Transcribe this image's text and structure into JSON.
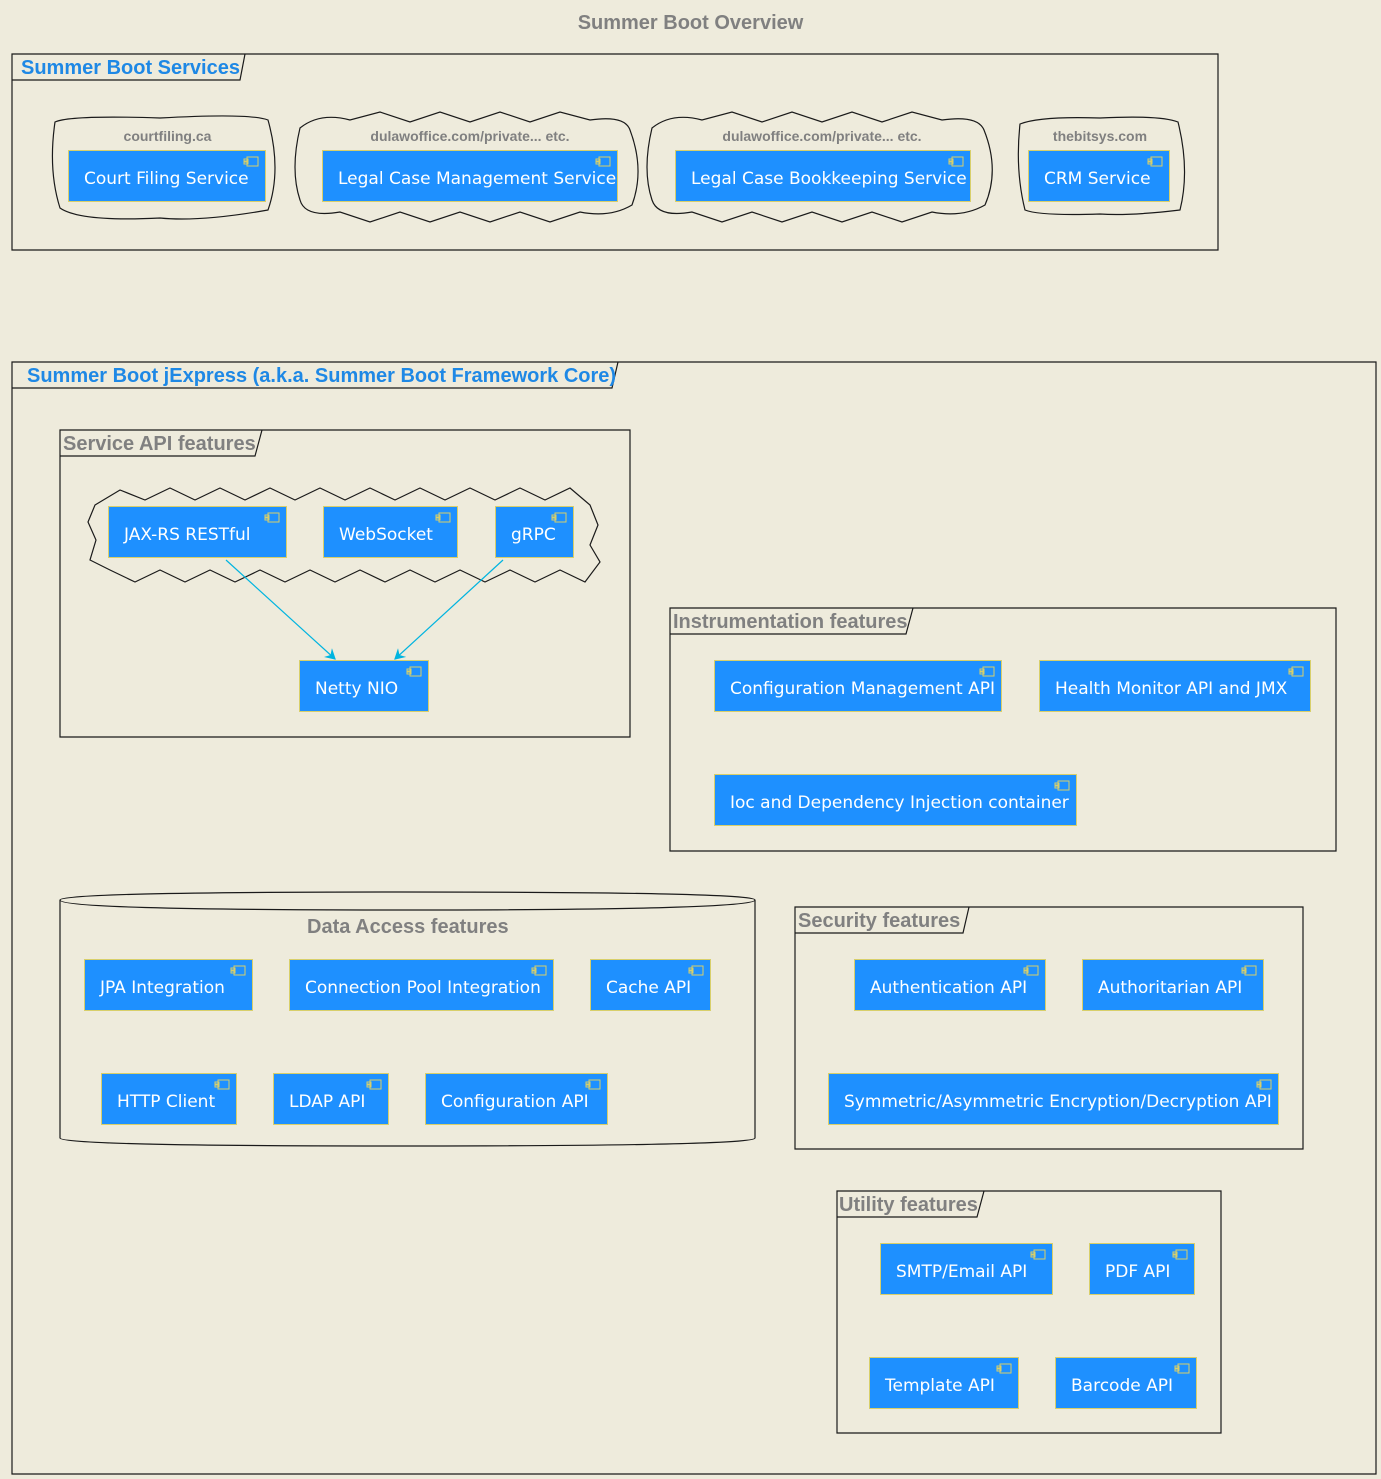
{
  "title": "Summer Boot Overview",
  "colors": {
    "background": "#EEEBDC",
    "component_fill": "#1E90FF",
    "component_border": "#D8CF6A",
    "package_title_blue": "#1E88E5",
    "package_title_grey": "#808080",
    "arrow": "#00B4E0"
  },
  "services_package": {
    "label": "Summer Boot Services",
    "clouds": [
      {
        "label": "courtfiling.ca",
        "component": "Court Filing Service"
      },
      {
        "label": "dulawoffice.com/private... etc.",
        "component": "Legal Case Management Service"
      },
      {
        "label": "dulawoffice.com/private... etc.",
        "component": "Legal Case Bookkeeping Service"
      },
      {
        "label": "thebitsys.com",
        "component": "CRM Service"
      }
    ]
  },
  "core_package": {
    "label": "Summer Boot jExpress (a.k.a. Summer Boot Framework Core)",
    "service_api": {
      "label": "Service API features",
      "components": [
        "JAX-RS RESTful",
        "WebSocket",
        "gRPC"
      ],
      "netty": "Netty NIO",
      "edges": [
        {
          "from": "JAX-RS RESTful",
          "to": "Netty NIO"
        },
        {
          "from": "gRPC",
          "to": "Netty NIO"
        }
      ]
    },
    "instrumentation": {
      "label": "Instrumentation features",
      "components": [
        "Configuration Management API",
        "Health Monitor API and JMX",
        "Ioc and Dependency Injection container"
      ]
    },
    "data_access": {
      "label": "Data Access features",
      "components": [
        "JPA Integration",
        "Connection Pool Integration",
        "Cache API",
        "HTTP Client",
        "LDAP API",
        "Configuration API"
      ]
    },
    "security": {
      "label": "Security features",
      "components": [
        "Authentication API",
        "Authoritarian API",
        "Symmetric/Asymmetric Encryption/Decryption API"
      ]
    },
    "utility": {
      "label": "Utility features",
      "components": [
        "SMTP/Email API",
        "PDF API",
        "Template API",
        "Barcode API"
      ]
    }
  }
}
